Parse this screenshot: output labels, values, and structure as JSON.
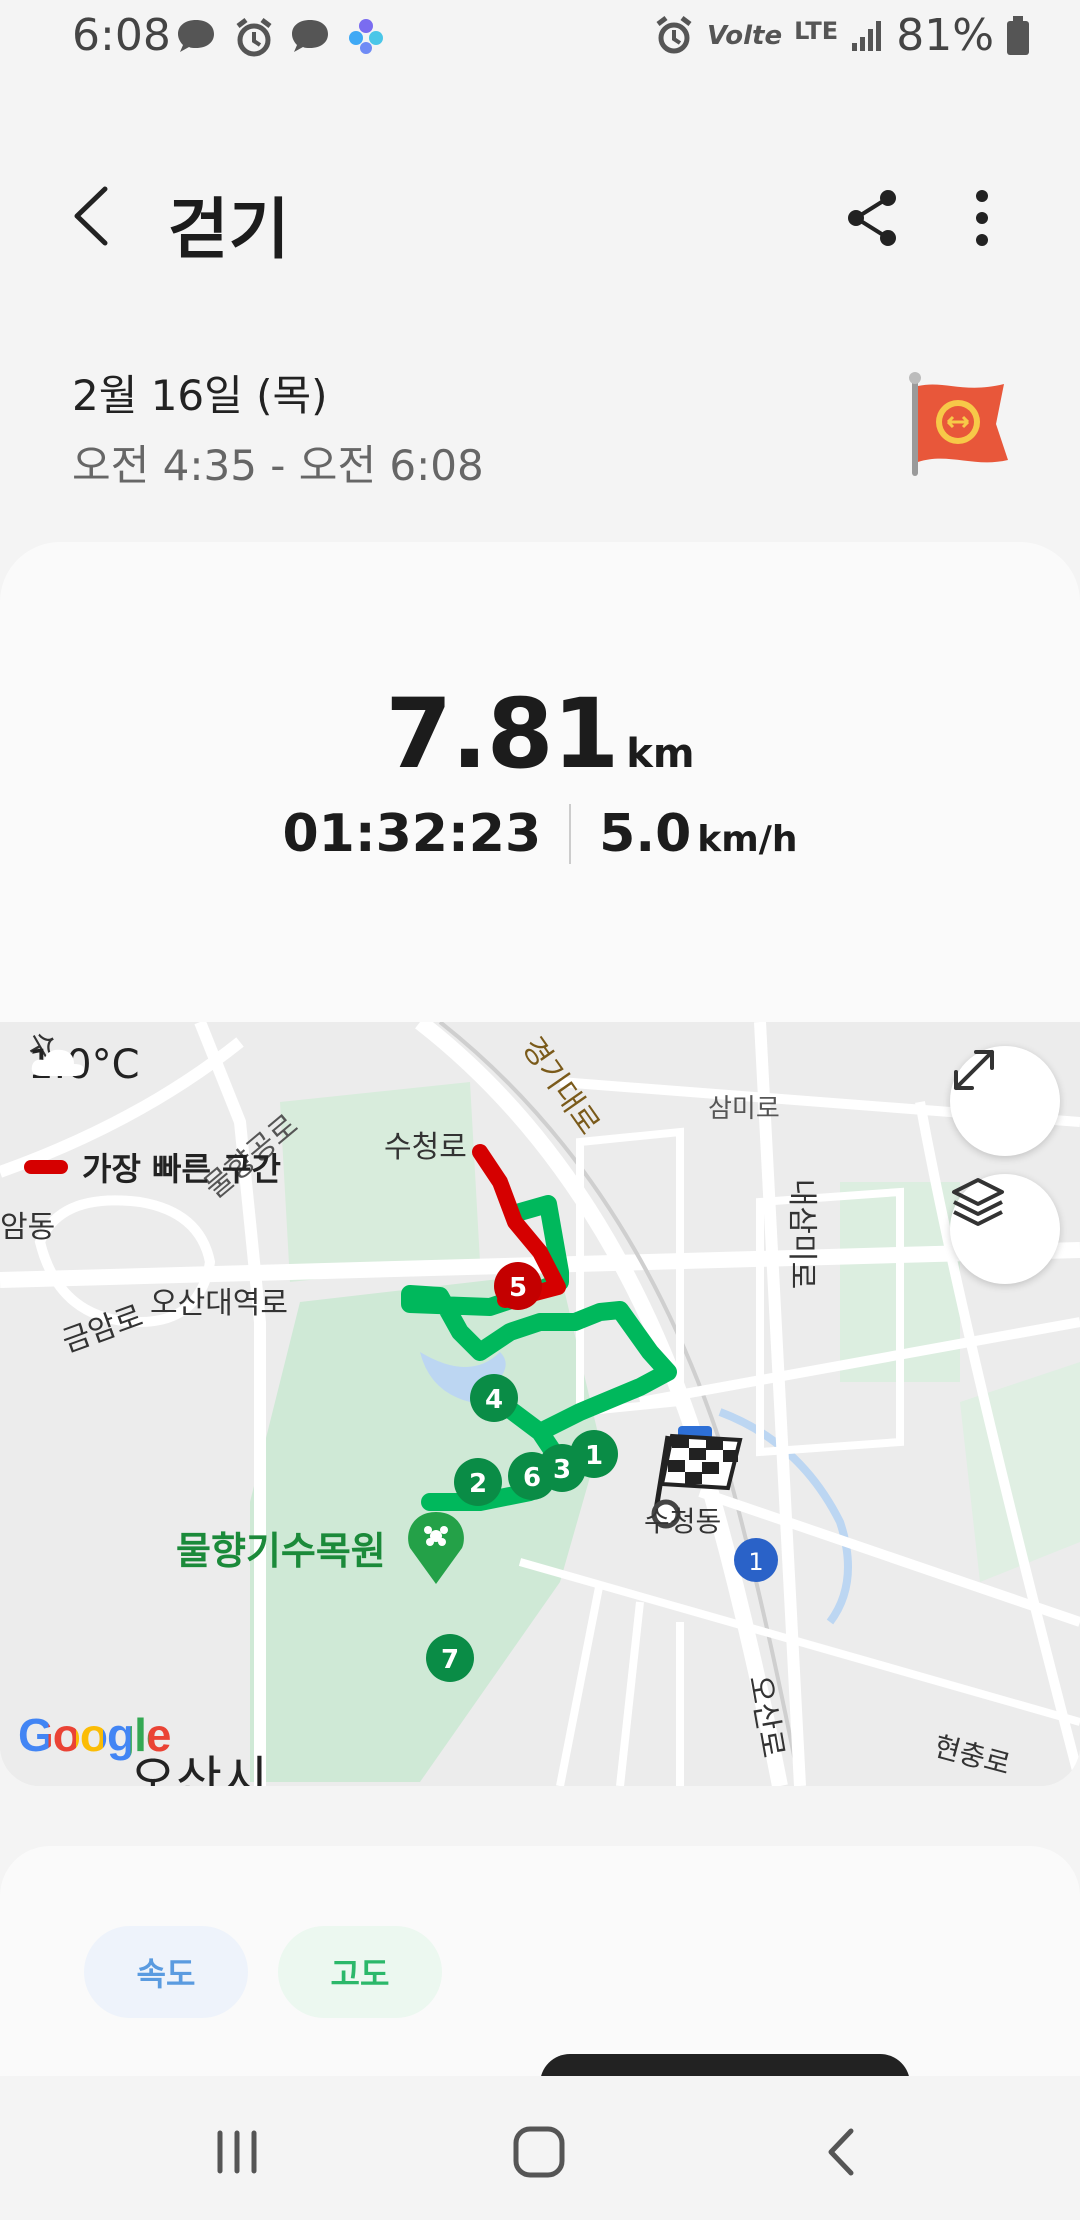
{
  "status_bar": {
    "time": "6:08",
    "network_label": "LTE",
    "volte_label": "Volte",
    "battery": "81%"
  },
  "header": {
    "title": "걷기",
    "back_icon": "chevron-left-icon",
    "share_icon": "share-icon",
    "more_icon": "more-vertical-icon"
  },
  "workout": {
    "date": "2월 16일 (목)",
    "time_range": "오전 4:35 - 오전 6:08",
    "distance_value": "7.81",
    "distance_unit": "km",
    "duration": "01:32:23",
    "speed_value": "5.0",
    "speed_unit": "km/h"
  },
  "map": {
    "temperature": "1.0°C",
    "legend_label": "가장 빠른 구간",
    "route_color": "#00b85c",
    "fastest_color": "#d50000",
    "lap_markers": [
      "1",
      "2",
      "3",
      "4",
      "5",
      "6",
      "7"
    ],
    "labels": {
      "road_gyeonggi": "경기대로",
      "road_sucheong": "수청로",
      "road_geumam": "금암로",
      "road_osandaeyeok": "오산대역로",
      "road_sammi": "삼미로",
      "road_naesammi": "내삼미로",
      "road_mulhyanggi": "물향공로",
      "road_osan": "오산로",
      "road_hyeonchung": "현충로",
      "park": "물향기수목원",
      "city": "오산시",
      "dong_am": "암동",
      "dong_su": "수청동",
      "road_shield": "1",
      "road_su": "수"
    },
    "google": "Google",
    "expand_icon": "expand-icon",
    "layers_icon": "layers-icon"
  },
  "graph": {
    "chip_speed": "속도",
    "chip_elevation": "고도"
  },
  "navbar": {
    "recent_icon": "recent-apps-icon",
    "home_icon": "home-icon",
    "back_icon": "back-icon"
  }
}
